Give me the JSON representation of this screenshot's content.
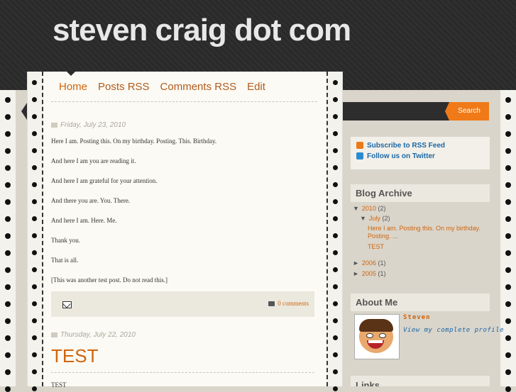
{
  "header": {
    "site_title": "steven craig dot com"
  },
  "nav": {
    "home": "Home",
    "posts_rss": "Posts RSS",
    "comments_rss": "Comments RSS",
    "edit": "Edit"
  },
  "posts": [
    {
      "date": "Friday, July 23, 2010",
      "lines": [
        "Here I am. Posting this. On my birthday. Posting. This. Birthday.",
        "And here I am you are reading it.",
        "And here I am grateful for your attention.",
        "And there you are. You. There.",
        "And here I am. Here. Me.",
        "Thank you.",
        "That is all.",
        "[This was another test post. Do not read this.]"
      ],
      "comments": "0 comments"
    },
    {
      "date": "Thursday, July 22, 2010",
      "title": "TEST",
      "body_start": "TEST"
    }
  ],
  "sidebar": {
    "search_label": "Search",
    "subscribe": "Subscribe to RSS Feed",
    "twitter": "Follow us on Twitter",
    "archive_title": "Blog Archive",
    "archive": {
      "y2010": "2010",
      "y2010_count": "(2)",
      "july": "July",
      "july_count": "(2)",
      "post1": "Here I am. Posting this. On my birthday. Posting. ...",
      "post2": "TEST",
      "y2006": "2006",
      "y2006_count": "(1)",
      "y2005": "2005",
      "y2005_count": "(1)"
    },
    "about_title": "About Me",
    "author": "Steven",
    "profile_link": "View my complete profile",
    "links_title": "Links"
  }
}
